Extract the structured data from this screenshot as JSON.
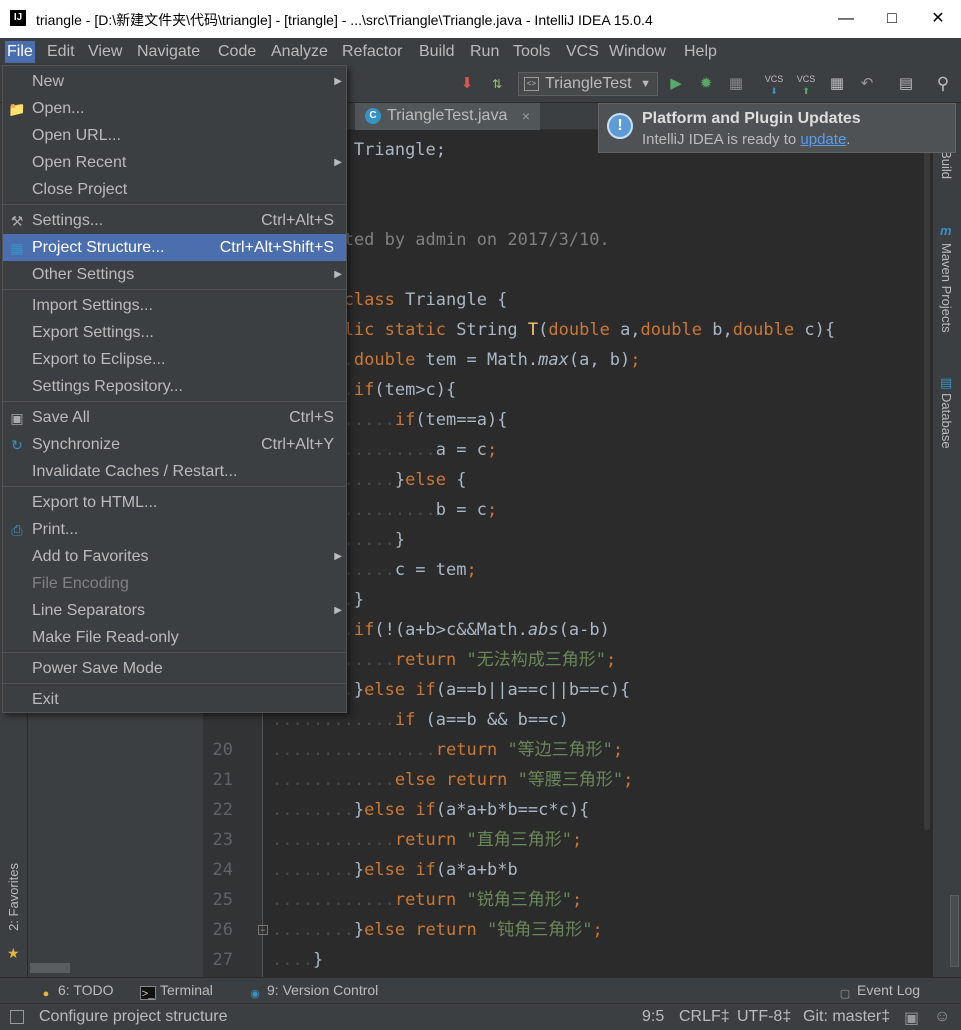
{
  "window": {
    "title": "triangle - [D:\\新建文件夹\\代码\\triangle] - [triangle] - ...\\src\\Triangle\\Triangle.java - IntelliJ IDEA 15.0.4",
    "app_icon": "IJ"
  },
  "menubar": [
    "File",
    "Edit",
    "View",
    "Navigate",
    "Code",
    "Analyze",
    "Refactor",
    "Build",
    "Run",
    "Tools",
    "VCS",
    "Window",
    "Help"
  ],
  "toolbar": {
    "run_config": "TriangleTest",
    "vcs_label": "VCS"
  },
  "file_menu": {
    "groups": [
      [
        {
          "label": "New",
          "submenu": true
        },
        {
          "label": "Open...",
          "icon": "folder-icon"
        },
        {
          "label": "Open URL..."
        },
        {
          "label": "Open Recent",
          "submenu": true
        },
        {
          "label": "Close Project"
        }
      ],
      [
        {
          "label": "Settings...",
          "shortcut": "Ctrl+Alt+S",
          "icon": "wrench-icon"
        },
        {
          "label": "Project Structure...",
          "shortcut": "Ctrl+Alt+Shift+S",
          "icon": "project-structure-icon",
          "highlighted": true
        },
        {
          "label": "Other Settings",
          "submenu": true
        }
      ],
      [
        {
          "label": "Import Settings..."
        },
        {
          "label": "Export Settings..."
        },
        {
          "label": "Export to Eclipse..."
        },
        {
          "label": "Settings Repository..."
        }
      ],
      [
        {
          "label": "Save All",
          "shortcut": "Ctrl+S",
          "icon": "save-icon"
        },
        {
          "label": "Synchronize",
          "shortcut": "Ctrl+Alt+Y",
          "icon": "sync-icon"
        },
        {
          "label": "Invalidate Caches / Restart..."
        }
      ],
      [
        {
          "label": "Export to HTML..."
        },
        {
          "label": "Print...",
          "icon": "print-icon"
        },
        {
          "label": "Add to Favorites",
          "submenu": true
        },
        {
          "label": "File Encoding",
          "disabled": true
        },
        {
          "label": "Line Separators",
          "submenu": true
        },
        {
          "label": "Make File Read-only"
        }
      ],
      [
        {
          "label": "Power Save Mode"
        }
      ],
      [
        {
          "label": "Exit"
        }
      ]
    ]
  },
  "editor": {
    "tab": "TriangleTest.java",
    "lines": [
      {
        "n": "",
        "html": "<span class='kw'>package</span> Triangle;"
      },
      {
        "n": "",
        "html": ""
      },
      {
        "n": "",
        "html": "<span class='cm'>/**</span>"
      },
      {
        "n": "",
        "html": "<span class='cm'> * Created by admin on 2017/3/10.</span>"
      },
      {
        "n": "",
        "html": "<span class='cm'> */</span>"
      },
      {
        "n": "",
        "html": "<span class='kw'>public class</span> Triangle {"
      },
      {
        "n": "",
        "html": "<span class='dot'>....</span><span class='kw'>public static</span> String <span class='fn'>T</span>(<span class='kw'>double</span> a,<span class='kw'>double</span> b,<span class='kw'>double</span> c){"
      },
      {
        "n": "",
        "html": "<span class='dot'>........</span><span class='kw'>double</span> tem = Math.<span class='it'>max</span>(a, b)<span class='kw'>;</span>"
      },
      {
        "n": "",
        "html": "<span class='dot'>........</span><span class='kw'>if</span>(tem>c){"
      },
      {
        "n": "",
        "html": "<span class='dot'>............</span><span class='kw'>if</span>(tem==a){"
      },
      {
        "n": "",
        "html": "<span class='dot'>................</span>a = c<span class='kw'>;</span>"
      },
      {
        "n": "",
        "html": "<span class='dot'>............</span>}<span class='kw'>else</span> {"
      },
      {
        "n": "",
        "html": "<span class='dot'>................</span>b = c<span class='kw'>;</span>"
      },
      {
        "n": "",
        "html": "<span class='dot'>............</span>}"
      },
      {
        "n": "",
        "html": "<span class='dot'>............</span>c = tem<span class='kw'>;</span>"
      },
      {
        "n": "",
        "html": "<span class='dot'>........</span>}"
      },
      {
        "n": "",
        "html": "<span class='dot'>........</span><span class='kw'>if</span>(!(a+b>c&&Math.<span class='it'>abs</span>(a-b)<c)){"
      },
      {
        "n": "",
        "html": "<span class='dot'>............</span><span class='kw'>return</span> <span class='str'>\"无法构成三角形\"</span><span class='kw'>;</span>"
      },
      {
        "n": "",
        "html": "<span class='dot'>........</span>}<span class='kw'>else if</span>(a==b||a==c||b==c){"
      },
      {
        "n": "",
        "html": "<span class='dot'>............</span><span class='kw'>if</span> (a==b && b==c)"
      },
      {
        "n": "20",
        "html": "<span class='dot'>................</span><span class='kw'>return</span> <span class='str'>\"等边三角形\"</span><span class='kw'>;</span>"
      },
      {
        "n": "21",
        "html": "<span class='dot'>............</span><span class='kw'>else return</span> <span class='str'>\"等腰三角形\"</span><span class='kw'>;</span>"
      },
      {
        "n": "22",
        "html": "<span class='dot'>........</span>}<span class='kw'>else if</span>(a*a+b*b==c*c){"
      },
      {
        "n": "23",
        "html": "<span class='dot'>............</span><span class='kw'>return</span> <span class='str'>\"直角三角形\"</span><span class='kw'>;</span>"
      },
      {
        "n": "24",
        "html": "<span class='dot'>........</span>}<span class='kw'>else if</span>(a*a+b*b<c*c){"
      },
      {
        "n": "25",
        "html": "<span class='dot'>............</span><span class='kw'>return</span> <span class='str'>\"锐角三角形\"</span><span class='kw'>;</span>"
      },
      {
        "n": "26",
        "html": "<span class='dot'>........</span>}<span class='kw'>else return</span> <span class='str'>\"钝角三角形\"</span><span class='kw'>;</span>"
      },
      {
        "n": "27",
        "html": "<span class='dot'>....</span>}"
      },
      {
        "n": "28",
        "html": "}"
      }
    ]
  },
  "notification": {
    "title": "Platform and Plugin Updates",
    "text": "IntelliJ IDEA is ready to",
    "link": "update",
    "suffix": "."
  },
  "right_stripe": [
    "Ant Build",
    "Maven Projects",
    "Database"
  ],
  "left_stripe": {
    "favorites": "2: Favorites"
  },
  "bottom_tools": [
    {
      "label": "6: TODO",
      "icon": "todo-icon"
    },
    {
      "label": "Terminal",
      "icon": "terminal-icon"
    },
    {
      "label": "9: Version Control",
      "icon": "vcs-icon"
    }
  ],
  "event_log": "Event Log",
  "status": {
    "message": "Configure project structure",
    "position": "9:5",
    "line_sep": "CRLF‡",
    "encoding": "UTF-8‡",
    "git": "Git: master‡"
  }
}
